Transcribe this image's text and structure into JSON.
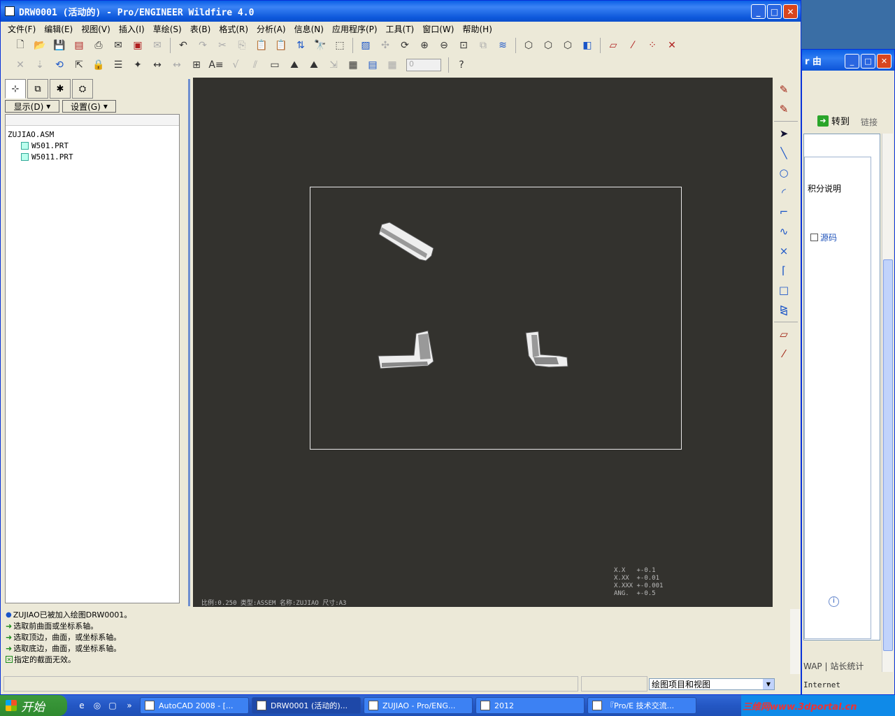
{
  "main_window": {
    "title": "DRW0001 (活动的) - Pro/ENGINEER Wildfire 4.0",
    "menu": [
      "文件(F)",
      "编辑(E)",
      "视图(V)",
      "插入(I)",
      "草绘(S)",
      "表(B)",
      "格式(R)",
      "分析(A)",
      "信息(N)",
      "应用程序(P)",
      "工具(T)",
      "窗口(W)",
      "帮助(H)"
    ]
  },
  "toolbar": {
    "spin_value": "0"
  },
  "left_panel": {
    "show_button": "显示(D)",
    "settings_button": "设置(G)",
    "tree": {
      "root": "ZUJIAO.ASM",
      "children": [
        "W501.PRT",
        "W5011.PRT"
      ]
    }
  },
  "drawing": {
    "tolerance": "X.X   +-0.1\nX.XX  +-0.01\nX.XXX +-0.001\nANG.  +-0.5",
    "scale_info": "比例:0.250   类型:ASSEM   名称:ZUJIAO   尺寸:A3"
  },
  "messages": [
    {
      "icon": "bullet",
      "text": "ZUJIAO已被加入绘图DRW0001。"
    },
    {
      "icon": "arrow",
      "text": "选取前曲面或坐标系轴。"
    },
    {
      "icon": "arrow",
      "text": "选取顶边，曲面，或坐标系轴。"
    },
    {
      "icon": "arrow",
      "text": "选取底边，曲面，或坐标系轴。"
    },
    {
      "icon": "error",
      "text": "指定的截面无效。"
    }
  ],
  "status": {
    "filter": "绘图项目和视图"
  },
  "background_window": {
    "title_fragment": "r 由",
    "goto": "转到",
    "links": "链接",
    "jifen": "积分说明",
    "yuanma": "源码",
    "footer": "WAP | 站长统计",
    "status": "Internet"
  },
  "taskbar": {
    "start": "开始",
    "tasks": [
      "AutoCAD 2008 - [...",
      "DRW0001 (活动的)...",
      "ZUJIAO - Pro/ENG...",
      "2012",
      "『Pro/E 技术交流..."
    ],
    "tray_text": "三维网www.3dportal.cn"
  }
}
